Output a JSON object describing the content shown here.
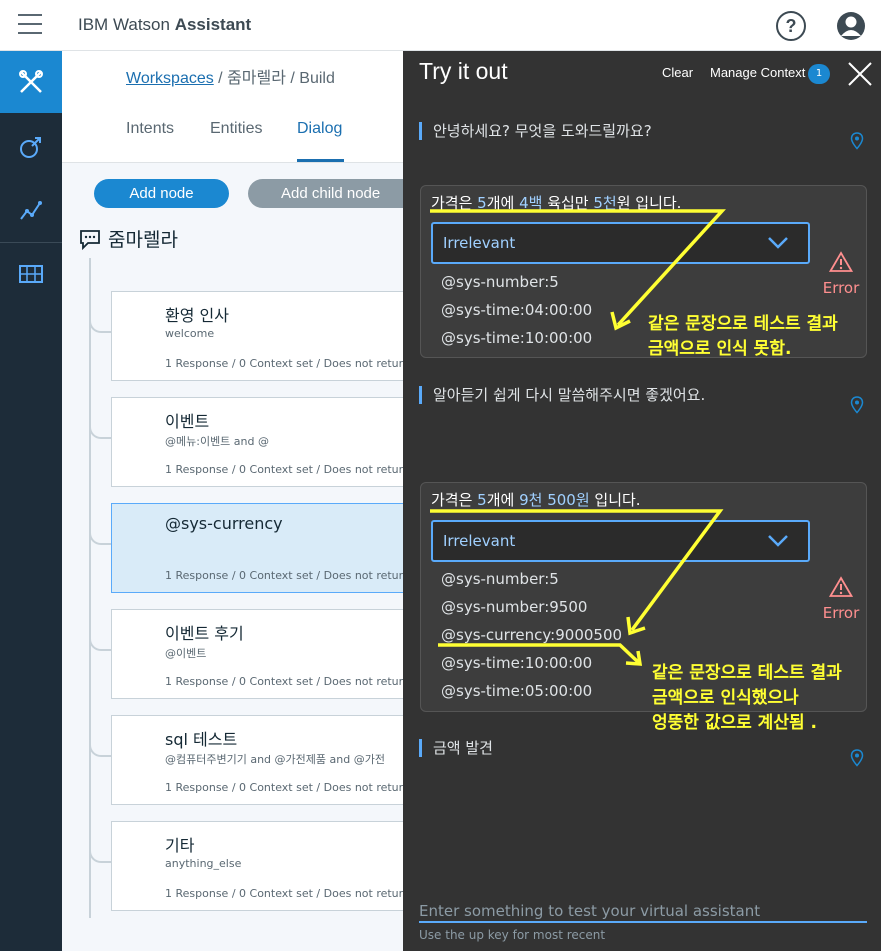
{
  "header": {
    "brand_prefix": "IBM Watson",
    "brand_name": "Assistant"
  },
  "breadcrumb": {
    "link": "Workspaces",
    "rest": " / 줌마렐라 / Build"
  },
  "tabs": [
    "Intents",
    "Entities",
    "Dialog"
  ],
  "active_tab": "Dialog",
  "buttons": {
    "add_node": "Add node",
    "add_child_node": "Add child node"
  },
  "root_node": "줌마렐라",
  "nodes": [
    {
      "title": "환영 인사",
      "condition": "welcome",
      "meta": "1 Response / 0 Context set / Does not retur"
    },
    {
      "title": "이벤트",
      "condition": "@메뉴:이벤트 and @",
      "meta": "1 Response / 0 Context set / Does not retur"
    },
    {
      "title": "@sys-currency",
      "condition": "",
      "meta": "1 Response / 0 Context set / Does not retur"
    },
    {
      "title": "이벤트 후기",
      "condition": "@이벤트",
      "meta": "1 Response / 0 Context set / Does not retur"
    },
    {
      "title": "sql 테스트",
      "condition": "@컴퓨터주변기기 and @가전제품 and @가전",
      "meta": "1 Response / 0 Context set / Does not retur"
    },
    {
      "title": "기타",
      "condition": "anything_else",
      "meta": "1 Response / 0 Context set / Does not retur"
    }
  ],
  "try_panel": {
    "title": "Try it out",
    "clear": "Clear",
    "manage_context": "Manage Context",
    "context_count": "1",
    "input_placeholder": "Enter something to test your virtual assistant",
    "input_hint": "Use the up key for most recent"
  },
  "conversation": {
    "bot_1": "안녕하세요? 무엇을 도와드릴까요?",
    "user_1": {
      "segments": [
        "가격은 ",
        "5",
        "개에 ",
        "4백",
        " 육십만 ",
        "5천",
        "원 입니다."
      ],
      "intent": "Irrelevant",
      "entities": [
        "@sys-number:5",
        "@sys-time:04:00:00",
        "@sys-time:10:00:00"
      ],
      "status": "Error"
    },
    "bot_2": "알아듣기 쉽게 다시 말씀해주시면 좋겠어요.",
    "user_2": {
      "segments": [
        "가격은 ",
        "5",
        "개에 ",
        "9천 500원",
        " 입니다."
      ],
      "intent": "Irrelevant",
      "entities": [
        "@sys-number:5",
        "@sys-number:9500",
        "@sys-currency:9000500",
        "@sys-time:10:00:00",
        "@sys-time:05:00:00"
      ],
      "status": "Error"
    },
    "bot_3": "금액 발견"
  },
  "annotations": {
    "note_1": [
      "같은 문장으로 테스트 결과",
      "금액으로 인식 못함."
    ],
    "note_2": [
      "같은 문장으로 테스트 결과",
      "금액으로 인식했으나",
      "엉뚱한 값으로 계산됨 ."
    ]
  },
  "colors": {
    "rail_bg": "#1d2c39",
    "accent": "#1b88d1",
    "panel_bg": "#333333",
    "annotation": "#ffff33",
    "error": "#ff8f8f"
  }
}
